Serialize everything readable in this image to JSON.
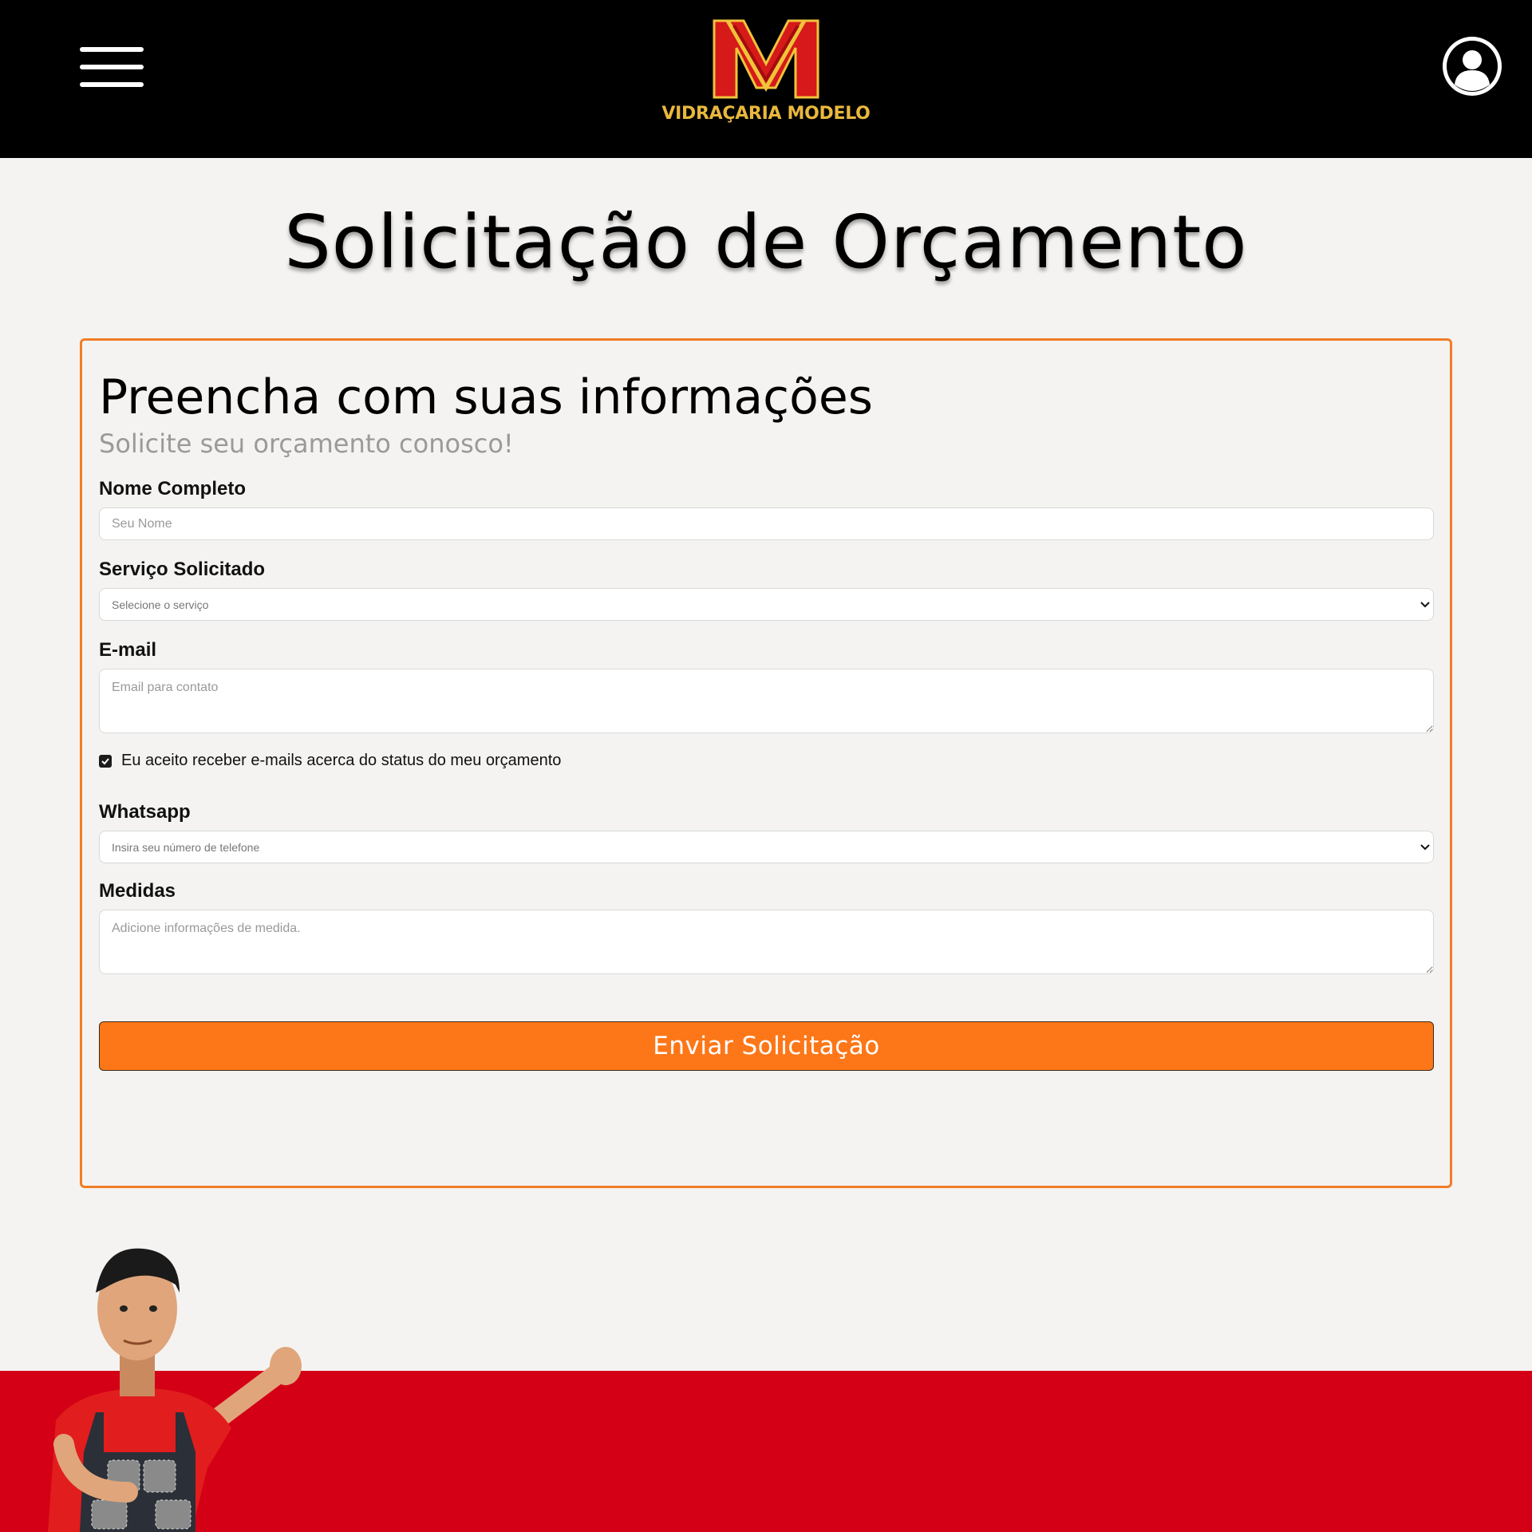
{
  "header": {
    "brand_name": "VIDRAÇARIA MODELO",
    "menu_icon": "hamburger-menu-icon",
    "user_icon": "user-avatar-icon"
  },
  "page": {
    "title": "Solicitação de Orçamento"
  },
  "form": {
    "heading": "Preencha com suas informações",
    "subheading": "Solicite seu orçamento conosco!",
    "name": {
      "label": "Nome Completo",
      "placeholder": "Seu Nome"
    },
    "service": {
      "label": "Serviço Solicitado",
      "selected": "Selecione o serviço"
    },
    "email": {
      "label": "E-mail",
      "placeholder": "Email para contato"
    },
    "consent": {
      "label": "Eu aceito receber e-mails acerca do status do meu orçamento",
      "checked": true
    },
    "whatsapp": {
      "label": "Whatsapp",
      "selected": "Insira seu número de telefone"
    },
    "measures": {
      "label": "Medidas",
      "placeholder": "Adicione informações de medida."
    },
    "submit_label": "Enviar Solicitação"
  },
  "colors": {
    "header_bg": "#000000",
    "accent_orange": "#fd7718",
    "card_border": "#f07d27",
    "footer_red": "#d30016",
    "logo_gold": "#e9b83c",
    "logo_red": "#d61a1a"
  }
}
